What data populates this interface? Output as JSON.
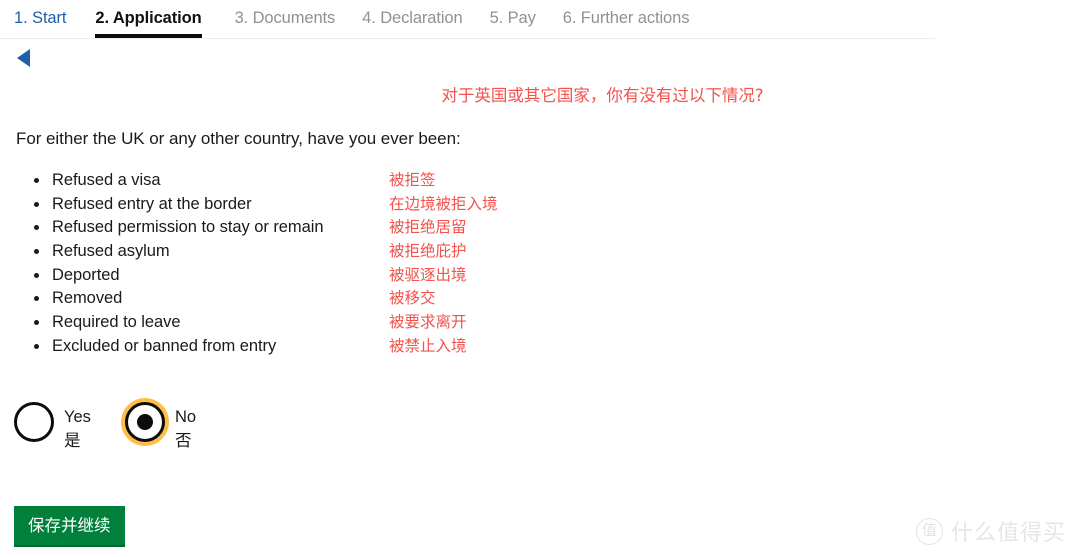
{
  "step_nav": {
    "steps": [
      {
        "label": "1. Start",
        "state": "link"
      },
      {
        "label": "2. Application",
        "state": "current"
      },
      {
        "label": "3. Documents",
        "state": "muted"
      },
      {
        "label": "4. Declaration",
        "state": "muted"
      },
      {
        "label": "5. Pay",
        "state": "muted"
      },
      {
        "label": "6. Further actions",
        "state": "muted"
      }
    ]
  },
  "back": {
    "icon": "back-arrow-icon"
  },
  "heading": {
    "zh": "对于英国或其它国家，你有没有过以下情况?"
  },
  "question": {
    "en": "For either the UK or any other country, have you ever been:"
  },
  "reasons": [
    {
      "en": "Refused a visa",
      "zh": "被拒签"
    },
    {
      "en": "Refused entry at the border",
      "zh": "在边境被拒入境"
    },
    {
      "en": "Refused permission to stay or remain",
      "zh": "被拒绝居留"
    },
    {
      "en": "Refused asylum",
      "zh": "被拒绝庇护"
    },
    {
      "en": "Deported",
      "zh": "被驱逐出境"
    },
    {
      "en": "Removed",
      "zh": "被移交"
    },
    {
      "en": "Required to leave",
      "zh": "被要求离开"
    },
    {
      "en": "Excluded or banned from entry",
      "zh": "被禁止入境"
    }
  ],
  "radio": {
    "yes": {
      "en": "Yes",
      "zh": "是",
      "selected": false,
      "focused": false
    },
    "no": {
      "en": "No",
      "zh": "否",
      "selected": true,
      "focused": true
    }
  },
  "actions": {
    "save_label": "保存并继续"
  },
  "watermark": {
    "badge": "值",
    "text": "什么值得买"
  },
  "colors": {
    "link_blue": "#1f5faa",
    "muted_gray": "#8e9296",
    "accent_red": "#f4524d",
    "focus_yellow": "#ffbf47",
    "button_green": "#00803a",
    "text_black": "#1a1a1a"
  }
}
